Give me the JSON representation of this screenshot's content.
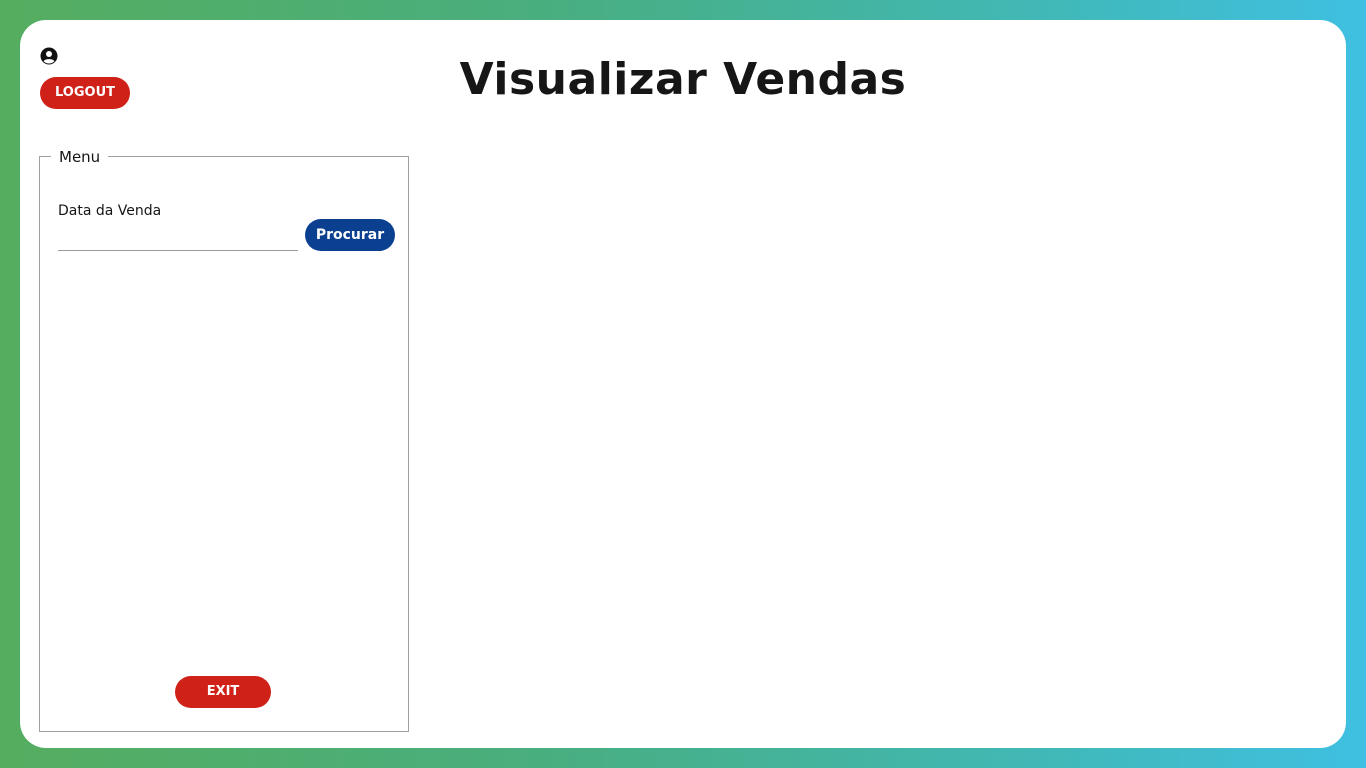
{
  "header": {
    "user_icon": "user-circle-icon",
    "logout_label": "LOGOUT",
    "title": "Visualizar Vendas"
  },
  "menu": {
    "legend": "Menu",
    "date_field": {
      "label": "Data da Venda",
      "value": "",
      "placeholder": ""
    },
    "search_label": "Procurar",
    "exit_label": "EXIT"
  },
  "colors": {
    "danger": "#cf2118",
    "primary": "#0b3f8f",
    "background_gradient_start": "#55ad5f",
    "background_gradient_end": "#3fc0e2"
  }
}
